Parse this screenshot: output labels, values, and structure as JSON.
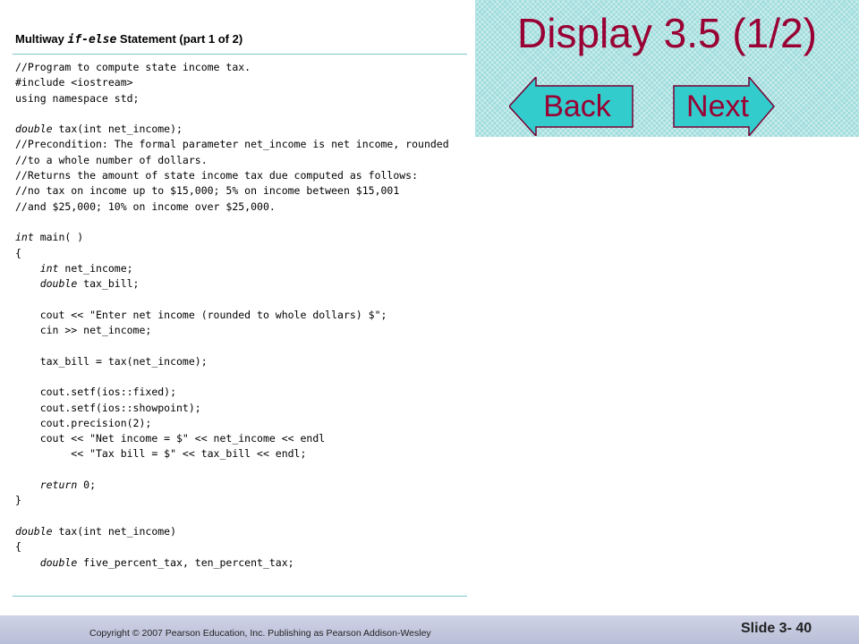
{
  "slide": {
    "title": "Display 3.5 (1/2)",
    "back_label": "Back",
    "next_label": "Next"
  },
  "display": {
    "caption_prefix": "Multiway ",
    "caption_keyword": "if-else",
    "caption_suffix": " Statement (part 1 of 2)",
    "code_lines": [
      "//Program to compute state income tax.",
      "#include <iostream>",
      "using namespace std;",
      "",
      "double tax(int net_income);",
      "//Precondition: The formal parameter net_income is net income, rounded",
      "//to a whole number of dollars.",
      "//Returns the amount of state income tax due computed as follows:",
      "//no tax on income up to $15,000; 5% on income between $15,001",
      "//and $25,000; 10% on income over $25,000.",
      "",
      "int main( )",
      "{",
      "    int net_income;",
      "    double tax_bill;",
      "",
      "    cout << \"Enter net income (rounded to whole dollars) $\";",
      "    cin >> net_income;",
      "",
      "    tax_bill = tax(net_income);",
      "",
      "    cout.setf(ios::fixed);",
      "    cout.setf(ios::showpoint);",
      "    cout.precision(2);",
      "    cout << \"Net income = $\" << net_income << endl",
      "         << \"Tax bill = $\" << tax_bill << endl;",
      "",
      "    return 0;",
      "}",
      "",
      "double tax(int net_income)",
      "{",
      "    double five_percent_tax, ten_percent_tax;"
    ]
  },
  "footer": {
    "copyright": "Copyright © 2007 Pearson Education, Inc. Publishing as Pearson Addison-Wesley",
    "slide_number": "Slide 3- 40"
  },
  "colors": {
    "title": "#990033",
    "header_bg": "#9fdcdc",
    "button_fill": "#33cccc",
    "footer_bg": "#c4c8df"
  }
}
